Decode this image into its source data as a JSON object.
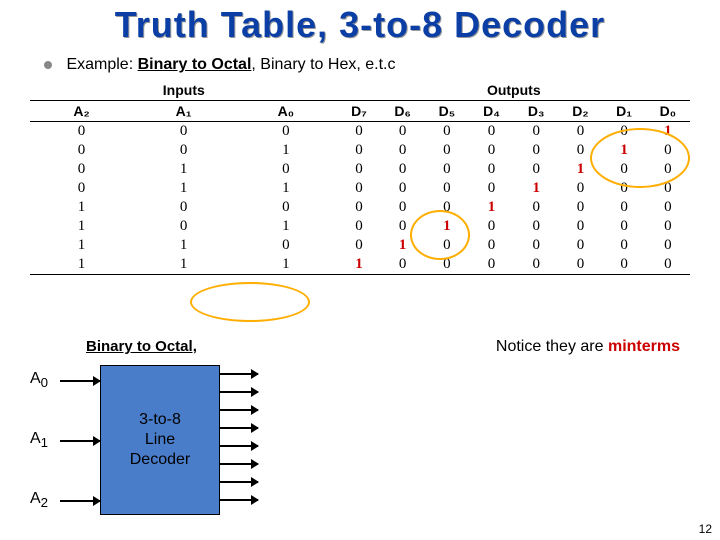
{
  "title": "Truth Table, 3-to-8 Decoder",
  "example": {
    "prefix": "Example: ",
    "binary_to_octal": "Binary to Octal",
    "suffix": ", Binary to Hex, e.t.c"
  },
  "group_headers": {
    "inputs": "Inputs",
    "outputs": "Outputs"
  },
  "columns": {
    "inputs": [
      "A₂",
      "A₁",
      "A₀"
    ],
    "outputs": [
      "D₇",
      "D₆",
      "D₅",
      "D₄",
      "D₃",
      "D₂",
      "D₁",
      "D₀"
    ]
  },
  "chart_data": {
    "type": "table",
    "title": "3-to-8 Decoder Truth Table",
    "input_columns": [
      "A2",
      "A1",
      "A0"
    ],
    "output_columns": [
      "D7",
      "D6",
      "D5",
      "D4",
      "D3",
      "D2",
      "D1",
      "D0"
    ],
    "rows": [
      {
        "A2": 0,
        "A1": 0,
        "A0": 0,
        "D7": 0,
        "D6": 0,
        "D5": 0,
        "D4": 0,
        "D3": 0,
        "D2": 0,
        "D1": 0,
        "D0": 1
      },
      {
        "A2": 0,
        "A1": 0,
        "A0": 1,
        "D7": 0,
        "D6": 0,
        "D5": 0,
        "D4": 0,
        "D3": 0,
        "D2": 0,
        "D1": 1,
        "D0": 0
      },
      {
        "A2": 0,
        "A1": 1,
        "A0": 0,
        "D7": 0,
        "D6": 0,
        "D5": 0,
        "D4": 0,
        "D3": 0,
        "D2": 1,
        "D1": 0,
        "D0": 0
      },
      {
        "A2": 0,
        "A1": 1,
        "A0": 1,
        "D7": 0,
        "D6": 0,
        "D5": 0,
        "D4": 0,
        "D3": 1,
        "D2": 0,
        "D1": 0,
        "D0": 0
      },
      {
        "A2": 1,
        "A1": 0,
        "A0": 0,
        "D7": 0,
        "D6": 0,
        "D5": 0,
        "D4": 1,
        "D3": 0,
        "D2": 0,
        "D1": 0,
        "D0": 0
      },
      {
        "A2": 1,
        "A1": 0,
        "A0": 1,
        "D7": 0,
        "D6": 0,
        "D5": 1,
        "D4": 0,
        "D3": 0,
        "D2": 0,
        "D1": 0,
        "D0": 0
      },
      {
        "A2": 1,
        "A1": 1,
        "A0": 0,
        "D7": 0,
        "D6": 1,
        "D5": 0,
        "D4": 0,
        "D3": 0,
        "D2": 0,
        "D1": 0,
        "D0": 0
      },
      {
        "A2": 1,
        "A1": 1,
        "A0": 1,
        "D7": 1,
        "D6": 0,
        "D5": 0,
        "D4": 0,
        "D3": 0,
        "D2": 0,
        "D1": 0,
        "D0": 0
      }
    ]
  },
  "subhead": "Binary to Octal,",
  "notice": {
    "pre": "Notice they are ",
    "word": "minterms"
  },
  "decoder": {
    "label": "3-to-8\nLine\nDecoder",
    "inputs": [
      "A0",
      "A1",
      "A2"
    ]
  },
  "page_num": "12"
}
